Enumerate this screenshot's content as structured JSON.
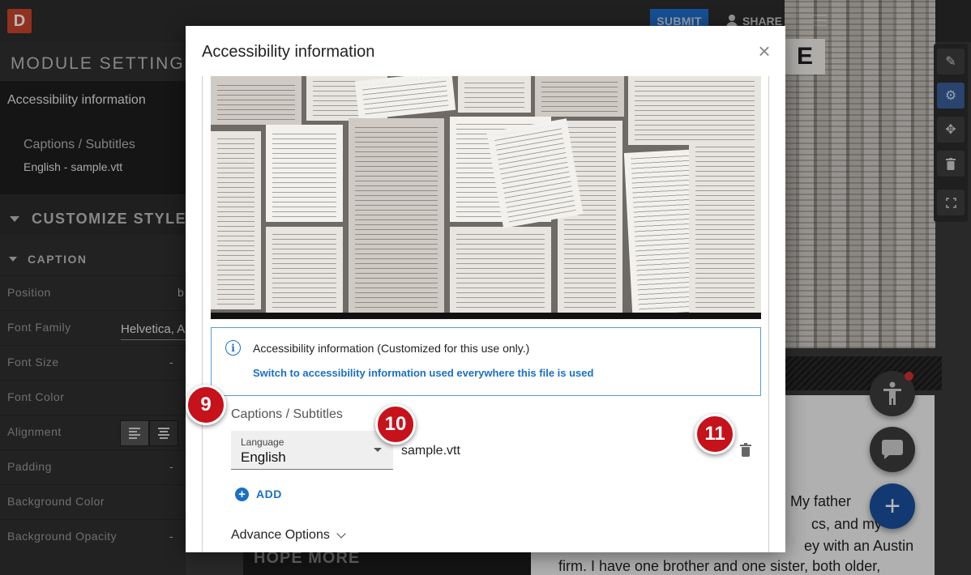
{
  "app": {
    "logo_letter": "D",
    "submit_label": "SUBMIT",
    "share_label": "SHARE"
  },
  "sidebar": {
    "title": "MODULE SETTINGS",
    "accessibility_heading": "Accessibility information",
    "captions_label": "Captions / Subtitles",
    "captions_file": "English - sample.vtt",
    "customize_heading": "CUSTOMIZE STYLE",
    "caption_heading": "CAPTION",
    "rows": [
      {
        "label": "Position",
        "value": "b"
      },
      {
        "label": "Font Family",
        "value": "Helvetica, A"
      },
      {
        "label": "Font Size",
        "value": "-"
      },
      {
        "label": "Font Color",
        "value": ""
      },
      {
        "label": "Alignment",
        "value": ""
      },
      {
        "label": "Padding",
        "value": "-"
      },
      {
        "label": "Background Color",
        "value": ""
      },
      {
        "label": "Background Opacity",
        "value": "-"
      }
    ]
  },
  "canvas": {
    "book_letter": "E",
    "poster_text": "HOPE MORE",
    "article_lines": [
      "s. My father",
      "cs, and my",
      "ey with an Austin",
      "firm. I have one brother and one sister, both older,"
    ]
  },
  "modal": {
    "title": "Accessibility information",
    "close_glyph": "×",
    "info_text": "Accessibility information (Customized for this use only.)",
    "info_link": "Switch to accessibility information used everywhere this file is used",
    "captions_label": "Captions / Subtitles",
    "language_label": "Language",
    "language_value": "English",
    "file_name": "sample.vtt",
    "add_label": "ADD",
    "advance_label": "Advance Options"
  },
  "markers": [
    "9",
    "10",
    "11"
  ],
  "colors": {
    "accent_blue": "#1a6fc4",
    "marker_red": "#c6121b",
    "info_border": "#5b9bd5"
  },
  "icons": {
    "tools": [
      "pencil-icon",
      "gear-icon",
      "move-icon",
      "trash-icon",
      "fullscreen-icon"
    ],
    "fabs": [
      "accessibility-icon",
      "chat-icon",
      "plus-icon"
    ]
  }
}
